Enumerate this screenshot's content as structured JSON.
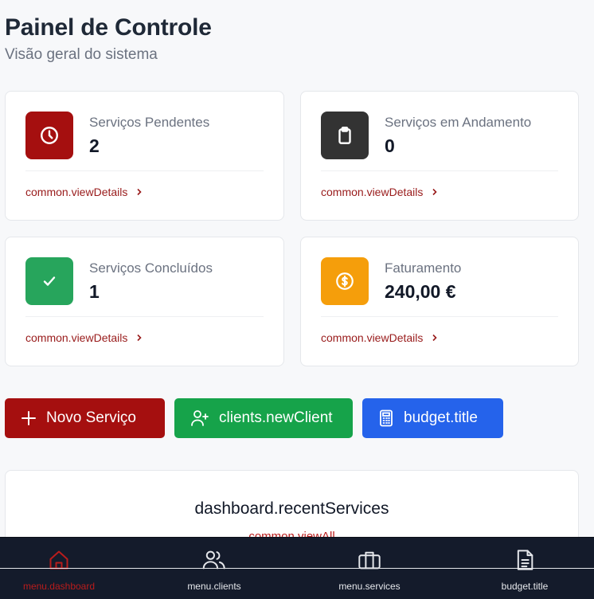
{
  "header": {
    "title": "Painel de Controle",
    "subtitle": "Visão geral do sistema"
  },
  "stats": [
    {
      "label": "Serviços Pendentes",
      "value": "2",
      "link": "common.viewDetails",
      "icon": "clock-icon",
      "color": "#a50f0f"
    },
    {
      "label": "Serviços em Andamento",
      "value": "0",
      "link": "common.viewDetails",
      "icon": "clipboard-icon",
      "color": "#333333"
    },
    {
      "label": "Serviços Concluídos",
      "value": "1",
      "link": "common.viewDetails",
      "icon": "check-icon",
      "color": "#27a55c"
    },
    {
      "label": "Faturamento",
      "value": "240,00 €",
      "link": "common.viewDetails",
      "icon": "dollar-circle-icon",
      "color": "#f59e0b"
    }
  ],
  "actions": {
    "new_service": "Novo Serviço",
    "new_client": "clients.newClient",
    "budget": "budget.title"
  },
  "recent": {
    "title": "dashboard.recentServices",
    "view_all": "common.viewAll"
  },
  "nav": [
    {
      "label": "menu.dashboard",
      "icon": "home-icon",
      "active": true
    },
    {
      "label": "menu.clients",
      "icon": "users-icon",
      "active": false
    },
    {
      "label": "menu.services",
      "icon": "briefcase-icon",
      "active": false
    },
    {
      "label": "budget.title",
      "icon": "document-icon",
      "active": false
    }
  ],
  "colors": {
    "primary": "#a50f0f",
    "success": "#16a34a",
    "info": "#2563eb",
    "nav_bg": "#141b2b"
  }
}
